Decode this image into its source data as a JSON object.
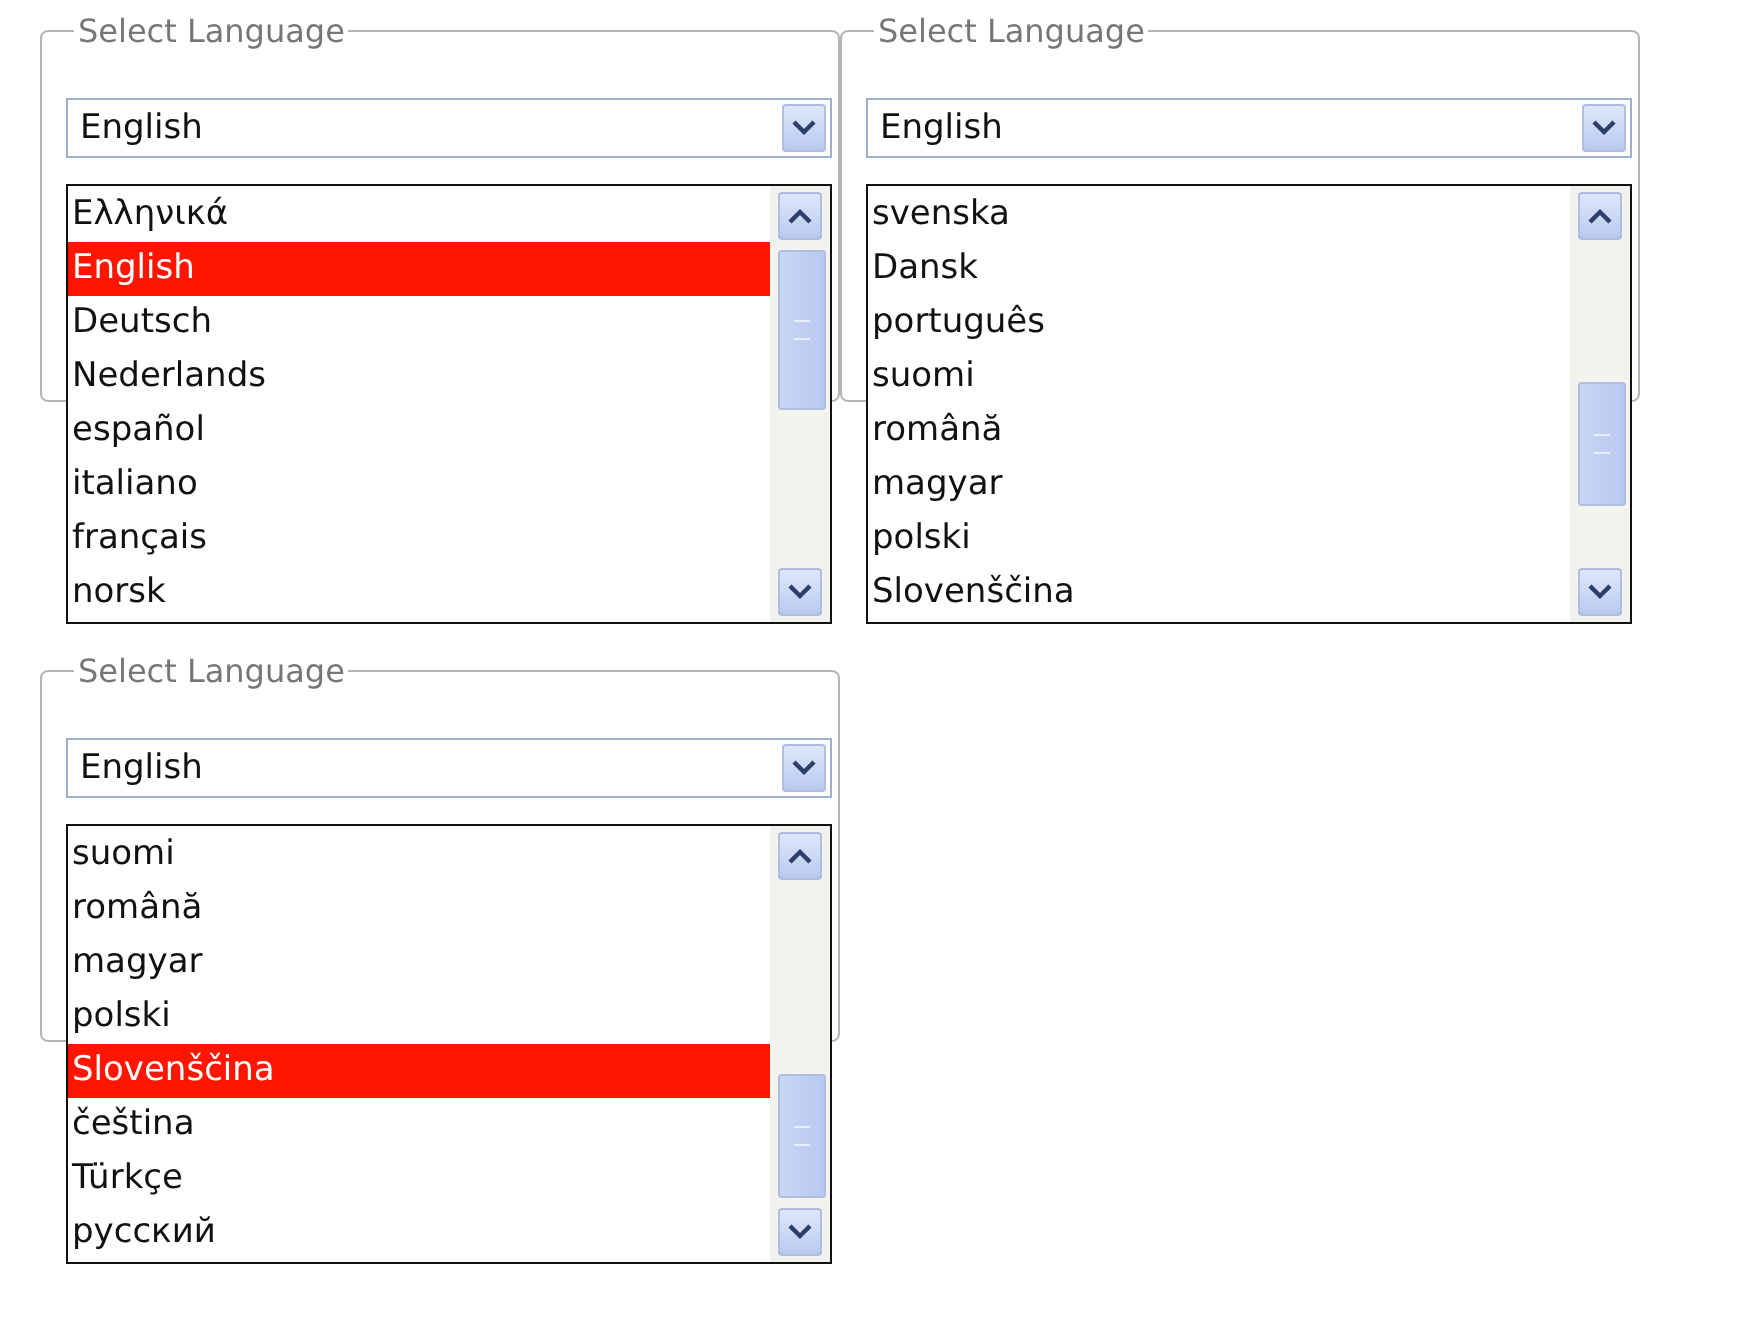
{
  "panels": [
    {
      "legend": "Select Language",
      "value": "English",
      "options": [
        {
          "label": "Ελληνικά",
          "selected": false
        },
        {
          "label": "English",
          "selected": true
        },
        {
          "label": "Deutsch",
          "selected": false
        },
        {
          "label": "Nederlands",
          "selected": false
        },
        {
          "label": "español",
          "selected": false
        },
        {
          "label": "italiano",
          "selected": false
        },
        {
          "label": "français",
          "selected": false
        },
        {
          "label": "norsk",
          "selected": false
        }
      ]
    },
    {
      "legend": "Select Language",
      "value": "English",
      "options": [
        {
          "label": "svenska",
          "selected": false
        },
        {
          "label": "Dansk",
          "selected": false
        },
        {
          "label": "português",
          "selected": false
        },
        {
          "label": "suomi",
          "selected": false
        },
        {
          "label": "română",
          "selected": false
        },
        {
          "label": "magyar",
          "selected": false
        },
        {
          "label": "polski",
          "selected": false
        },
        {
          "label": "Slovenščina",
          "selected": false
        }
      ]
    },
    {
      "legend": "Select Language",
      "value": "English",
      "options": [
        {
          "label": "suomi",
          "selected": false
        },
        {
          "label": "română",
          "selected": false
        },
        {
          "label": "magyar",
          "selected": false
        },
        {
          "label": "polski",
          "selected": false
        },
        {
          "label": "Slovenščina",
          "selected": true
        },
        {
          "label": "čeština",
          "selected": false
        },
        {
          "label": "Türkçe",
          "selected": false
        },
        {
          "label": "русский",
          "selected": false
        }
      ]
    }
  ]
}
